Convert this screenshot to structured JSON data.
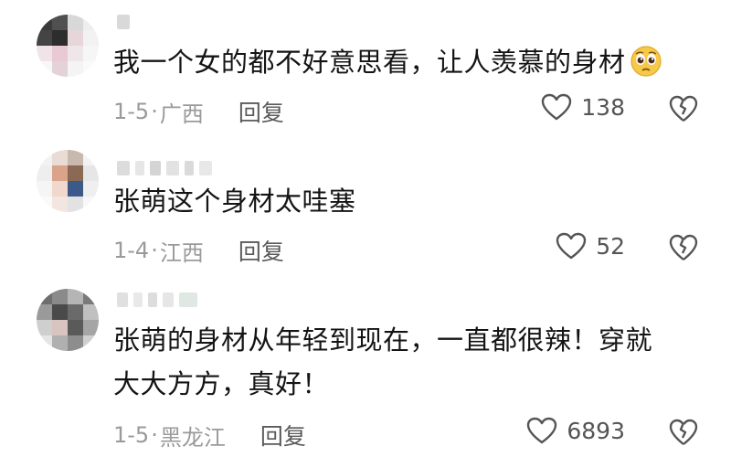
{
  "comments": [
    {
      "text": "我一个女的都不好意思看，让人羡慕的身材",
      "emoji_icon": "pleading-face-icon",
      "date": "1-5",
      "location": "广西",
      "reply_label": "回复",
      "likes": "138"
    },
    {
      "text": "张萌这个身材太哇塞",
      "date": "1-4",
      "location": "江西",
      "reply_label": "回复",
      "likes": "52"
    },
    {
      "text_line1": "张萌的身材从年轻到现在，一直都很辣！穿就",
      "text_line2": "大大方方，真好！",
      "date": "1-5",
      "location": "黑龙江",
      "reply_label": "回复",
      "likes": "6893"
    }
  ],
  "separator": "·",
  "colors": {
    "meta_text": "#9a9a9a",
    "reply_text": "#5a5a5a",
    "icon_stroke": "#555555"
  }
}
